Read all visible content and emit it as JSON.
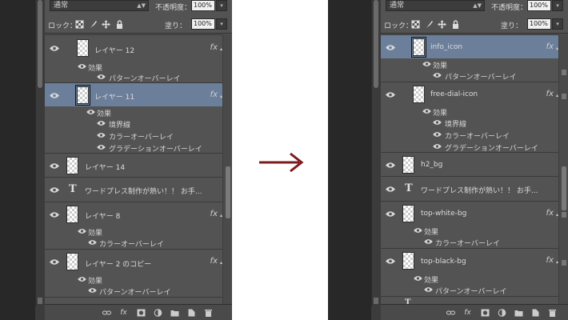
{
  "before": {
    "blend_mode": "通常",
    "opacity_label": "不透明度：",
    "opacity_value": "100%",
    "lock_label": "ロック：",
    "fill_label": "塗り：",
    "fill_value": "100%",
    "layers": [
      {
        "name": "レイヤー 12",
        "type": "image",
        "fx": true,
        "selected": false,
        "effects_label": "効果",
        "effects": [
          "パターンオーバーレイ"
        ]
      },
      {
        "name": "レイヤー 11",
        "type": "image",
        "fx": true,
        "selected": true,
        "effects_label": "効果",
        "effects": [
          "境界線",
          "カラーオーバーレイ",
          "グラデーションオーバーレイ"
        ]
      },
      {
        "name": "レイヤー 14",
        "type": "image",
        "fx": false,
        "selected": false
      },
      {
        "name": "ワードプレス制作が熱い！！ お手...",
        "type": "text",
        "fx": false,
        "selected": false
      },
      {
        "name": "レイヤー 8",
        "type": "image",
        "fx": true,
        "selected": false,
        "effects_label": "効果",
        "effects": [
          "カラーオーバーレイ"
        ]
      },
      {
        "name": "レイヤー 2 のコピー",
        "type": "image",
        "fx": true,
        "selected": false,
        "effects_label": "効果",
        "effects": [
          "パターンオーバーレイ"
        ]
      }
    ]
  },
  "after": {
    "blend_mode": "通常",
    "opacity_label": "不透明度：",
    "opacity_value": "100%",
    "lock_label": "ロック：",
    "fill_label": "塗り：",
    "fill_value": "100%",
    "layers": [
      {
        "name": "info_icon",
        "type": "image",
        "fx": true,
        "selected": true,
        "effects_label": "効果",
        "effects": [
          "パターンオーバーレイ"
        ]
      },
      {
        "name": "free-dial-icon",
        "type": "image",
        "fx": true,
        "selected": false,
        "effects_label": "効果",
        "effects": [
          "境界線",
          "カラーオーバーレイ",
          "グラデーションオーバーレイ"
        ]
      },
      {
        "name": "h2_bg",
        "type": "image",
        "fx": false,
        "selected": false
      },
      {
        "name": "ワードプレス制作が熱い！！ お手...",
        "type": "text",
        "fx": false,
        "selected": false
      },
      {
        "name": "top-white-bg",
        "type": "image",
        "fx": true,
        "selected": false,
        "effects_label": "効果",
        "effects": [
          "カラーオーバーレイ"
        ]
      },
      {
        "name": "top-black-bg",
        "type": "image",
        "fx": true,
        "selected": false,
        "effects_label": "効果",
        "effects": [
          "パターンオーバーレイ"
        ]
      }
    ]
  },
  "fx_label": "fx",
  "text_layer_icon": "T",
  "colors": {
    "selected_row": "#6b7f9a",
    "panel_bg": "#535353",
    "arrow": "#7b1a1a"
  }
}
